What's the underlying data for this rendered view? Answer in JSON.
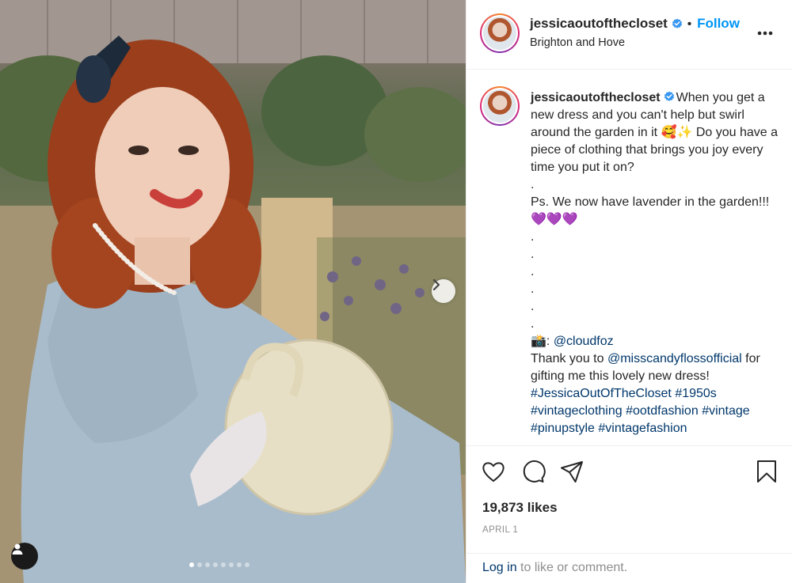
{
  "post": {
    "username": "jessicaoutofthecloset",
    "follow_label": "Follow",
    "location": "Brighton and Hove",
    "header_separator": "•",
    "more_icon": "more-horizontal-icon"
  },
  "caption": {
    "username": "jessicaoutofthecloset",
    "line1": "When you get a new dress and you can't help but swirl around the garden in it 🥰✨ Do you have a piece of clothing that brings you joy every time you put it on?",
    "dot": ".",
    "line2": "Ps. We now have lavender in the garden!!! ",
    "hearts": "💜💜💜",
    "camera": "📸: ",
    "photographer": "@cloudfoz",
    "thanks_prefix": "Thank you to ",
    "sponsor": "@misscandyflossofficial",
    "thanks_suffix": " for gifting me this lovely new dress!",
    "hashtags": [
      "#JessicaOutOfTheCloset",
      "#1950s",
      "#vintageclothing",
      "#ootdfashion",
      "#vintage",
      "#pinupstyle",
      "#vintagefashion"
    ]
  },
  "stats": {
    "likes": "19,873 likes",
    "date": "APRIL 1"
  },
  "footer": {
    "login_link": "Log in",
    "login_suffix": " to like or comment."
  },
  "carousel": {
    "slide_count": 8,
    "active_index": 0
  },
  "colors": {
    "accent": "#0095f6",
    "link": "#00376b",
    "muted": "#8e8e8e",
    "text": "#262626"
  }
}
